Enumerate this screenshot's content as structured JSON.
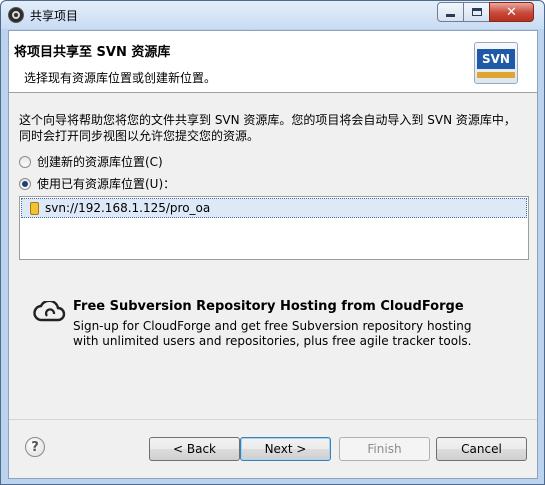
{
  "window": {
    "title": "共享项目",
    "controls": {
      "minimize_icon": "minimize-icon",
      "maximize_icon": "maximize-icon",
      "close_label": "✕"
    }
  },
  "header": {
    "title": "将项目共享至 SVN 资源库",
    "subtitle": "选择现有资源库位置或创建新位置。",
    "logo_text": "SVN"
  },
  "description": {
    "line1": "这个向导将帮助您将您的文件共享到 SVN 资源库。您的项目将会自动导入到 SVN 资源库中，",
    "line2": "同时会打开同步视图以允许您提交您的资源。"
  },
  "options": {
    "create_new": {
      "label": "创建新的资源库位置(C)",
      "checked": false
    },
    "use_existing": {
      "label": "使用已有资源库位置(U)：",
      "checked": true
    }
  },
  "repositories": [
    {
      "url": "svn://192.168.1.125/pro_oa",
      "selected": true
    }
  ],
  "promo": {
    "title": "Free Subversion Repository Hosting from CloudForge",
    "line1": "Sign-up for CloudForge and get free Subversion repository hosting",
    "line2": "with unlimited users and repositories, plus free agile tracker tools."
  },
  "buttons": {
    "help": "?",
    "back": "< Back",
    "next": "Next >",
    "finish": "Finish",
    "cancel": "Cancel"
  }
}
